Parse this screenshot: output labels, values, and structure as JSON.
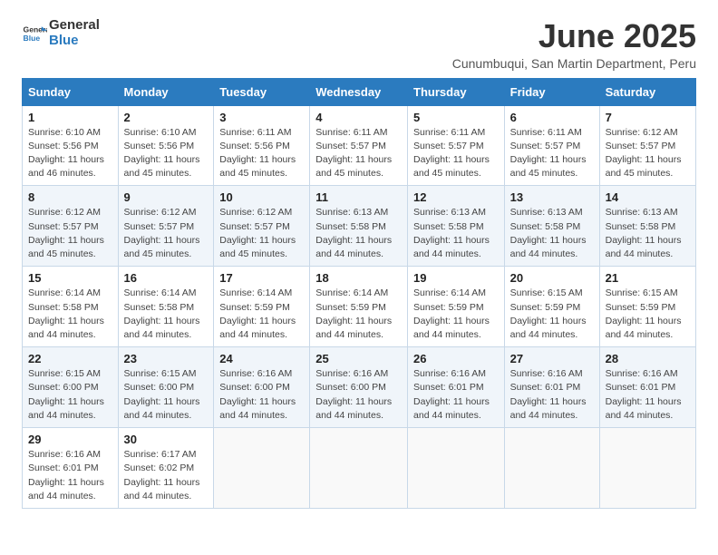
{
  "header": {
    "logo_line1": "General",
    "logo_line2": "Blue",
    "month_title": "June 2025",
    "subtitle": "Cunumbuqui, San Martin Department, Peru"
  },
  "days_of_week": [
    "Sunday",
    "Monday",
    "Tuesday",
    "Wednesday",
    "Thursday",
    "Friday",
    "Saturday"
  ],
  "weeks": [
    [
      {
        "day": "1",
        "sunrise": "6:10 AM",
        "sunset": "5:56 PM",
        "daylight": "11 hours and 46 minutes."
      },
      {
        "day": "2",
        "sunrise": "6:10 AM",
        "sunset": "5:56 PM",
        "daylight": "11 hours and 45 minutes."
      },
      {
        "day": "3",
        "sunrise": "6:11 AM",
        "sunset": "5:56 PM",
        "daylight": "11 hours and 45 minutes."
      },
      {
        "day": "4",
        "sunrise": "6:11 AM",
        "sunset": "5:57 PM",
        "daylight": "11 hours and 45 minutes."
      },
      {
        "day": "5",
        "sunrise": "6:11 AM",
        "sunset": "5:57 PM",
        "daylight": "11 hours and 45 minutes."
      },
      {
        "day": "6",
        "sunrise": "6:11 AM",
        "sunset": "5:57 PM",
        "daylight": "11 hours and 45 minutes."
      },
      {
        "day": "7",
        "sunrise": "6:12 AM",
        "sunset": "5:57 PM",
        "daylight": "11 hours and 45 minutes."
      }
    ],
    [
      {
        "day": "8",
        "sunrise": "6:12 AM",
        "sunset": "5:57 PM",
        "daylight": "11 hours and 45 minutes."
      },
      {
        "day": "9",
        "sunrise": "6:12 AM",
        "sunset": "5:57 PM",
        "daylight": "11 hours and 45 minutes."
      },
      {
        "day": "10",
        "sunrise": "6:12 AM",
        "sunset": "5:57 PM",
        "daylight": "11 hours and 45 minutes."
      },
      {
        "day": "11",
        "sunrise": "6:13 AM",
        "sunset": "5:58 PM",
        "daylight": "11 hours and 44 minutes."
      },
      {
        "day": "12",
        "sunrise": "6:13 AM",
        "sunset": "5:58 PM",
        "daylight": "11 hours and 44 minutes."
      },
      {
        "day": "13",
        "sunrise": "6:13 AM",
        "sunset": "5:58 PM",
        "daylight": "11 hours and 44 minutes."
      },
      {
        "day": "14",
        "sunrise": "6:13 AM",
        "sunset": "5:58 PM",
        "daylight": "11 hours and 44 minutes."
      }
    ],
    [
      {
        "day": "15",
        "sunrise": "6:14 AM",
        "sunset": "5:58 PM",
        "daylight": "11 hours and 44 minutes."
      },
      {
        "day": "16",
        "sunrise": "6:14 AM",
        "sunset": "5:58 PM",
        "daylight": "11 hours and 44 minutes."
      },
      {
        "day": "17",
        "sunrise": "6:14 AM",
        "sunset": "5:59 PM",
        "daylight": "11 hours and 44 minutes."
      },
      {
        "day": "18",
        "sunrise": "6:14 AM",
        "sunset": "5:59 PM",
        "daylight": "11 hours and 44 minutes."
      },
      {
        "day": "19",
        "sunrise": "6:14 AM",
        "sunset": "5:59 PM",
        "daylight": "11 hours and 44 minutes."
      },
      {
        "day": "20",
        "sunrise": "6:15 AM",
        "sunset": "5:59 PM",
        "daylight": "11 hours and 44 minutes."
      },
      {
        "day": "21",
        "sunrise": "6:15 AM",
        "sunset": "5:59 PM",
        "daylight": "11 hours and 44 minutes."
      }
    ],
    [
      {
        "day": "22",
        "sunrise": "6:15 AM",
        "sunset": "6:00 PM",
        "daylight": "11 hours and 44 minutes."
      },
      {
        "day": "23",
        "sunrise": "6:15 AM",
        "sunset": "6:00 PM",
        "daylight": "11 hours and 44 minutes."
      },
      {
        "day": "24",
        "sunrise": "6:16 AM",
        "sunset": "6:00 PM",
        "daylight": "11 hours and 44 minutes."
      },
      {
        "day": "25",
        "sunrise": "6:16 AM",
        "sunset": "6:00 PM",
        "daylight": "11 hours and 44 minutes."
      },
      {
        "day": "26",
        "sunrise": "6:16 AM",
        "sunset": "6:01 PM",
        "daylight": "11 hours and 44 minutes."
      },
      {
        "day": "27",
        "sunrise": "6:16 AM",
        "sunset": "6:01 PM",
        "daylight": "11 hours and 44 minutes."
      },
      {
        "day": "28",
        "sunrise": "6:16 AM",
        "sunset": "6:01 PM",
        "daylight": "11 hours and 44 minutes."
      }
    ],
    [
      {
        "day": "29",
        "sunrise": "6:16 AM",
        "sunset": "6:01 PM",
        "daylight": "11 hours and 44 minutes."
      },
      {
        "day": "30",
        "sunrise": "6:17 AM",
        "sunset": "6:02 PM",
        "daylight": "11 hours and 44 minutes."
      },
      null,
      null,
      null,
      null,
      null
    ]
  ]
}
